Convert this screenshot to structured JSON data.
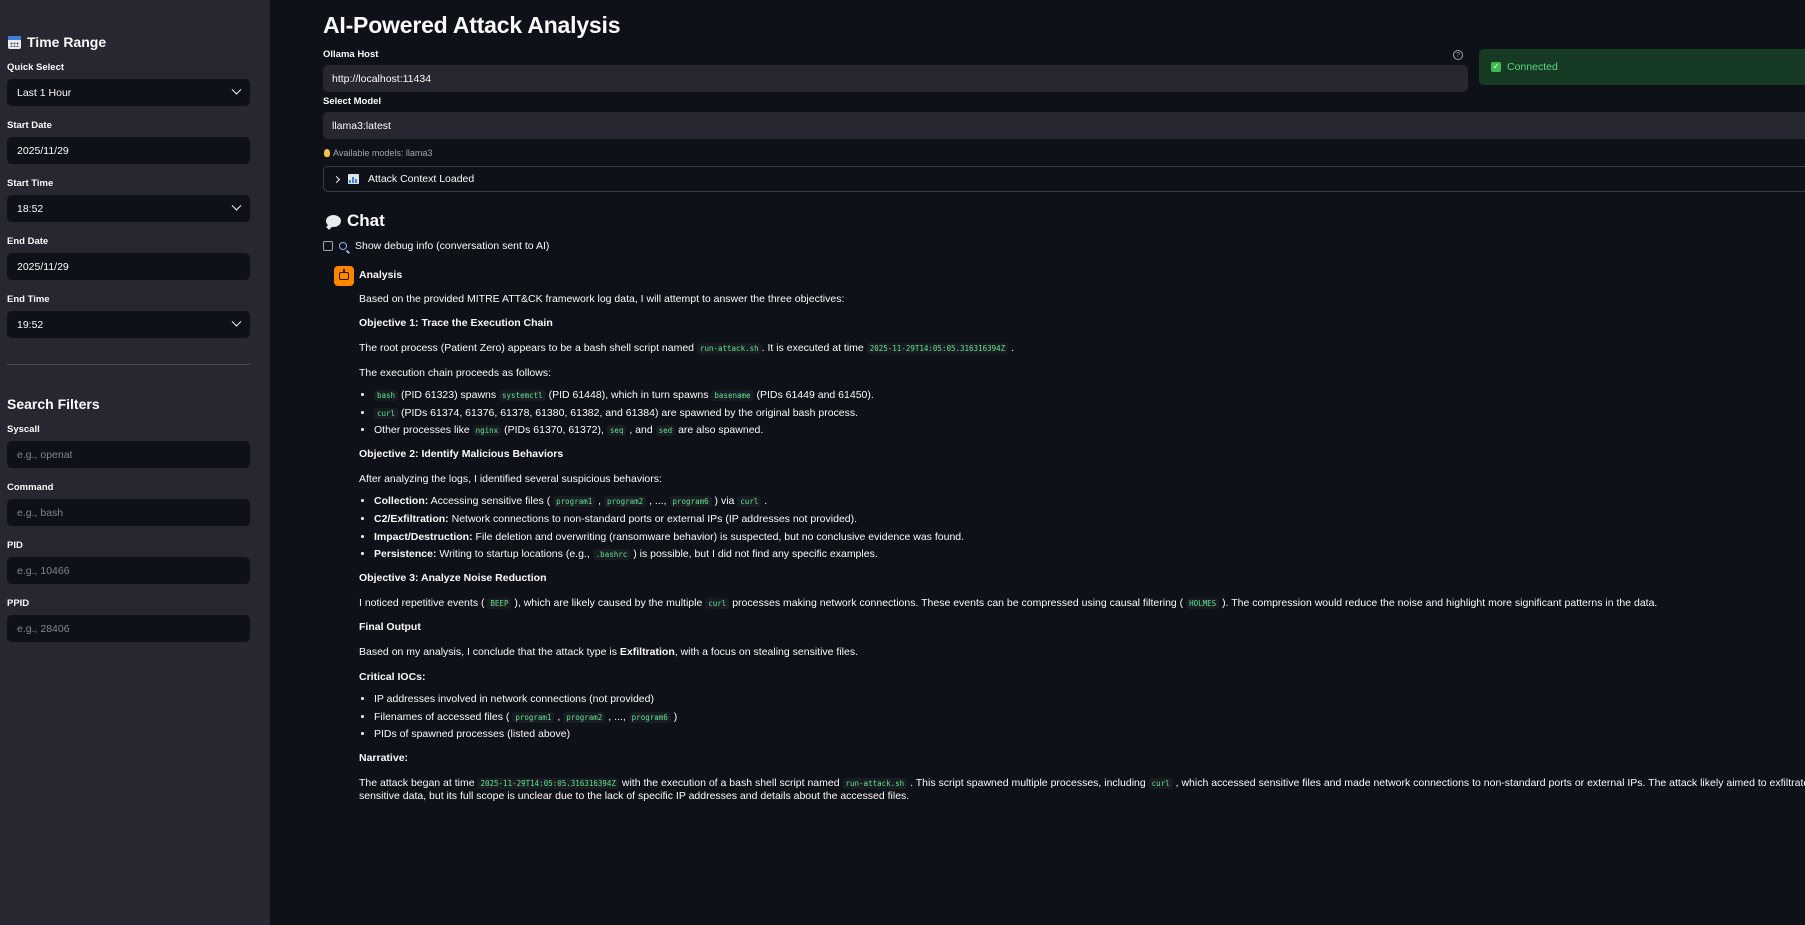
{
  "sidebar": {
    "time_range_title": "Time Range",
    "quick_select": {
      "label": "Quick Select",
      "value": "Last 1 Hour"
    },
    "start_date": {
      "label": "Start Date",
      "value": "2025/11/29"
    },
    "start_time": {
      "label": "Start Time",
      "value": "18:52"
    },
    "end_date": {
      "label": "End Date",
      "value": "2025/11/29"
    },
    "end_time": {
      "label": "End Time",
      "value": "19:52"
    },
    "filters_title": "Search Filters",
    "syscall": {
      "label": "Syscall",
      "placeholder": "e.g., openat"
    },
    "command": {
      "label": "Command",
      "placeholder": "e.g., bash"
    },
    "pid": {
      "label": "PID",
      "placeholder": "e.g., 10466"
    },
    "ppid": {
      "label": "PPID",
      "placeholder": "e.g., 28406"
    }
  },
  "main": {
    "title": "AI-Powered Attack Analysis",
    "host": {
      "label": "Ollama Host",
      "value": "http://localhost:11434"
    },
    "status": "Connected",
    "model": {
      "label": "Select Model",
      "value": "llama3:latest"
    },
    "available_models": "Available models: llama3",
    "expander_label": "Attack Context Loaded",
    "chat_title": "Chat",
    "debug_label": "Show debug info (conversation sent to AI)"
  },
  "message": {
    "name": "Analysis",
    "intro": "Based on the provided MITRE ATT&CK framework log data, I will attempt to answer the three objectives:",
    "obj1_title": "Objective 1: Trace the Execution Chain",
    "obj1_p1_a": "The root process (Patient Zero) appears to be a bash shell script named",
    "obj1_p1_code1": "run-attack.sh",
    "obj1_p1_b": ". It is executed at time",
    "obj1_p1_code2": "2025-11-29T14:05:05.316316394Z",
    "obj1_p1_c": ".",
    "obj1_p2": "The execution chain proceeds as follows:",
    "obj1_li1": {
      "c1": "bash",
      "t1": " (PID 61323) spawns ",
      "c2": "systemctl",
      "t2": " (PID 61448), which in turn spawns ",
      "c3": "basename",
      "t3": " (PIDs 61449 and 61450)."
    },
    "obj1_li2": {
      "c1": "curl",
      "t1": " (PIDs 61374, 61376, 61378, 61380, 61382, and 61384) are spawned by the original bash process."
    },
    "obj1_li3": {
      "t0": "Other processes like ",
      "c1": "nginx",
      "t1": " (PIDs 61370, 61372), ",
      "c2": "seq",
      "t2": " , and ",
      "c3": "sed",
      "t3": " are also spawned."
    },
    "obj2_title": "Objective 2: Identify Malicious Behaviors",
    "obj2_p1": "After analyzing the logs, I identified several suspicious behaviors:",
    "obj2_li1": {
      "b": "Collection:",
      "t0": " Accessing sensitive files ( ",
      "c1": "program1",
      "t1": " , ",
      "c2": "program2",
      "t2": " , ..., ",
      "c3": "program6",
      "t3": " ) via ",
      "c4": "curl",
      "t4": " ."
    },
    "obj2_li2": {
      "b": "C2/Exfiltration:",
      "t0": " Network connections to non-standard ports or external IPs (IP addresses not provided)."
    },
    "obj2_li3": {
      "b": "Impact/Destruction:",
      "t0": " File deletion and overwriting (ransomware behavior) is suspected, but no conclusive evidence was found."
    },
    "obj2_li4": {
      "b": "Persistence:",
      "t0": " Writing to startup locations (e.g., ",
      "c1": ".bashrc",
      "t1": " ) is possible, but I did not find any specific examples."
    },
    "obj3_title": "Objective 3: Analyze Noise Reduction",
    "obj3_p1": {
      "t0": "I noticed repetitive events ( ",
      "c1": "BEEP",
      "t1": " ), which are likely caused by the multiple ",
      "c2": "curl",
      "t2": " processes making network connections. These events can be compressed using causal filtering ( ",
      "c3": "HOLMES",
      "t3": " ). The compression would reduce the noise and highlight more significant patterns in the data."
    },
    "final_title": "Final Output",
    "final_p1": {
      "t0": "Based on my analysis, I conclude that the attack type is ",
      "b": "Exfiltration",
      "t1": ", with a focus on stealing sensitive files."
    },
    "iocs_title": "Critical IOCs:",
    "ioc_li1": "IP addresses involved in network connections (not provided)",
    "ioc_li2": {
      "t0": "Filenames of accessed files ( ",
      "c1": "program1",
      "t1": " , ",
      "c2": "program2",
      "t2": " , ..., ",
      "c3": "program6",
      "t3": " )"
    },
    "ioc_li3": "PIDs of spawned processes (listed above)",
    "narrative_title": "Narrative:",
    "narrative": {
      "t0": "The attack began at time ",
      "c1": "2025-11-29T14:05:05.316316394Z",
      "t1": " with the execution of a bash shell script named ",
      "c2": "run-attack.sh",
      "t2": " . This script spawned multiple processes, including ",
      "c3": "curl",
      "t3": " , which accessed sensitive files and made network connections to non-standard ports or external IPs. The attack likely aimed to exfiltrate sensitive data, but its full scope is unclear due to the lack of specific IP addresses and details about the accessed files."
    }
  },
  "colors": {
    "accent": "#ff8700",
    "success": "#56d87e",
    "code": "#5ce488",
    "background": "#0e1117",
    "sidebar": "#262730"
  }
}
